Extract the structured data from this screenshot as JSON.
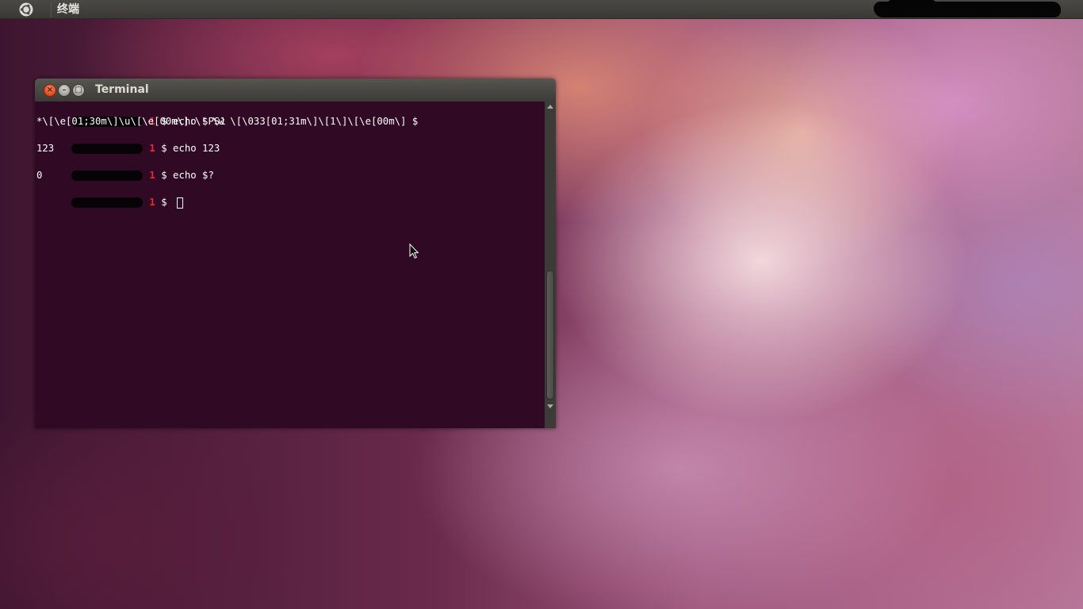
{
  "top_panel": {
    "app_title": "终端",
    "logo_icon": "ubuntu-logo-icon"
  },
  "terminal_window": {
    "title": "Terminal",
    "buttons": {
      "close": "×",
      "minimize": "–",
      "maximize": "□"
    },
    "lines": [
      {
        "type": "prompt",
        "history": "1",
        "text": " $ echo $PS1"
      },
      {
        "type": "output",
        "text": "*\\[\\e[01;30m\\]\\u\\[\\e[00m\\]:\\! \\w \\[\\033[01;31m\\]\\[1\\]\\[\\e[00m\\] $"
      },
      {
        "type": "prompt",
        "history": "1",
        "text": " $ echo 123"
      },
      {
        "type": "output",
        "text": "123"
      },
      {
        "type": "prompt",
        "history": "1",
        "text": " $ echo $?"
      },
      {
        "type": "output",
        "text": "0"
      },
      {
        "type": "prompt",
        "history": "1",
        "text": " $ "
      }
    ],
    "colors": {
      "background": "#300a24",
      "foreground": "#ffffff",
      "history_number": "#ef2929"
    }
  }
}
